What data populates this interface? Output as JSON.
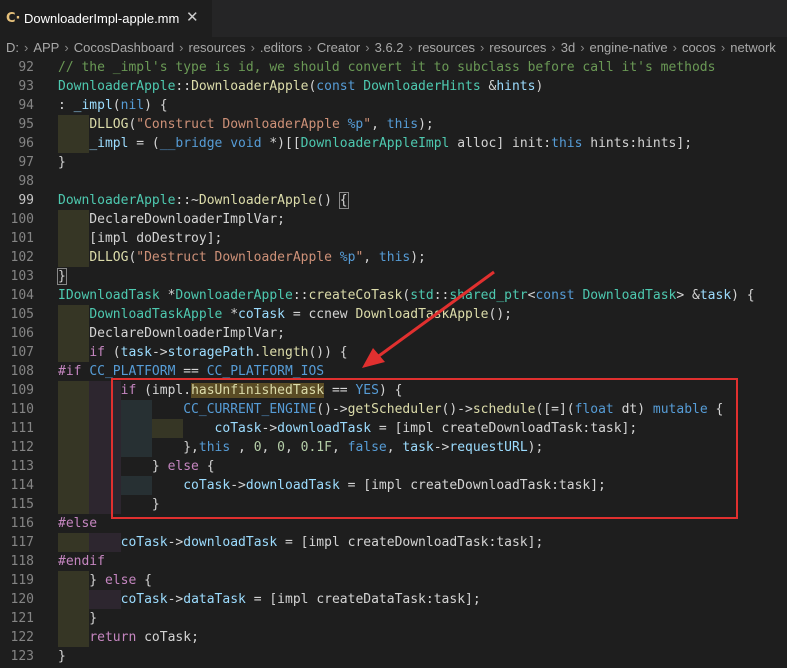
{
  "tab": {
    "icon": "C·",
    "label": "DownloaderImpl-apple.mm",
    "close": "✕"
  },
  "breadcrumb": [
    "D:",
    "APP",
    "CocosDashboard",
    "resources",
    ".editors",
    "Creator",
    "3.6.2",
    "resources",
    "resources",
    "3d",
    "engine-native",
    "cocos",
    "network"
  ],
  "breadcrumb_sep": "›",
  "colors": {
    "comment": "#6a9955",
    "keyword": "#569cd6",
    "control": "#c586c0",
    "type": "#4ec9b0",
    "function": "#dcdcaa",
    "variable": "#9cdcfe",
    "string": "#ce9178",
    "number": "#b5cea8",
    "macro": "#569cd6",
    "text": "#d4d4d4",
    "highlight_box": "#e1302f"
  },
  "lines": [
    {
      "n": 92,
      "parts": [
        [
          "c",
          "// the _impl's type is id, we should convert it to subclass before call it's methods"
        ]
      ]
    },
    {
      "n": 93,
      "parts": [
        [
          "y",
          "DownloaderApple"
        ],
        [
          "p",
          "::"
        ],
        [
          "f",
          "DownloaderApple"
        ],
        [
          "p",
          "("
        ],
        [
          "k",
          "const"
        ],
        [
          "p",
          " "
        ],
        [
          "y",
          "DownloaderHints"
        ],
        [
          "p",
          " &"
        ],
        [
          "v",
          "hints"
        ],
        [
          "p",
          ")"
        ]
      ]
    },
    {
      "n": 94,
      "parts": [
        [
          "p",
          ": "
        ],
        [
          "v",
          "_impl"
        ],
        [
          "p",
          "("
        ],
        [
          "k",
          "nil"
        ],
        [
          "p",
          ") {"
        ]
      ]
    },
    {
      "n": 95,
      "parts": [
        [
          "p",
          "    "
        ],
        [
          "f",
          "DLLOG"
        ],
        [
          "p",
          "("
        ],
        [
          "s",
          "\"Construct DownloaderApple "
        ],
        [
          "k",
          "%p"
        ],
        [
          "s",
          "\""
        ],
        [
          "p",
          ", "
        ],
        [
          "k",
          "this"
        ],
        [
          "p",
          ");"
        ]
      ]
    },
    {
      "n": 96,
      "parts": [
        [
          "p",
          "    "
        ],
        [
          "v",
          "_impl"
        ],
        [
          "p",
          " = ("
        ],
        [
          "k",
          "__bridge"
        ],
        [
          "p",
          " "
        ],
        [
          "k",
          "void"
        ],
        [
          "p",
          " *)[["
        ],
        [
          "y",
          "DownloaderAppleImpl"
        ],
        [
          "p",
          " alloc] init:"
        ],
        [
          "k",
          "this"
        ],
        [
          "p",
          " hints:hints];"
        ]
      ]
    },
    {
      "n": 97,
      "parts": [
        [
          "p",
          "}"
        ]
      ]
    },
    {
      "n": 98,
      "parts": []
    },
    {
      "n": 99,
      "parts": [
        [
          "y",
          "DownloaderApple"
        ],
        [
          "p",
          "::~"
        ],
        [
          "f",
          "DownloaderApple"
        ],
        [
          "p",
          "() "
        ],
        [
          "p",
          "{"
        ]
      ]
    },
    {
      "n": 100,
      "parts": [
        [
          "p",
          "    DeclareDownloaderImplVar;"
        ]
      ]
    },
    {
      "n": 101,
      "parts": [
        [
          "p",
          "    [impl doDestroy];"
        ]
      ]
    },
    {
      "n": 102,
      "parts": [
        [
          "p",
          "    "
        ],
        [
          "f",
          "DLLOG"
        ],
        [
          "p",
          "("
        ],
        [
          "s",
          "\"Destruct DownloaderApple "
        ],
        [
          "k",
          "%p"
        ],
        [
          "s",
          "\""
        ],
        [
          "p",
          ", "
        ],
        [
          "k",
          "this"
        ],
        [
          "p",
          ");"
        ]
      ]
    },
    {
      "n": 103,
      "parts": [
        [
          "p",
          "}"
        ]
      ]
    },
    {
      "n": 104,
      "parts": [
        [
          "y",
          "IDownloadTask"
        ],
        [
          "p",
          " *"
        ],
        [
          "y",
          "DownloaderApple"
        ],
        [
          "p",
          "::"
        ],
        [
          "f",
          "createCoTask"
        ],
        [
          "p",
          "("
        ],
        [
          "y",
          "std"
        ],
        [
          "p",
          "::"
        ],
        [
          "y",
          "shared_ptr"
        ],
        [
          "p",
          "<"
        ],
        [
          "k",
          "const"
        ],
        [
          "p",
          " "
        ],
        [
          "y",
          "DownloadTask"
        ],
        [
          "p",
          "> &"
        ],
        [
          "v",
          "task"
        ],
        [
          "p",
          ") {"
        ]
      ]
    },
    {
      "n": 105,
      "parts": [
        [
          "p",
          "    "
        ],
        [
          "y",
          "DownloadTaskApple"
        ],
        [
          "p",
          " *"
        ],
        [
          "v",
          "coTask"
        ],
        [
          "p",
          " = ccnew "
        ],
        [
          "f",
          "DownloadTaskApple"
        ],
        [
          "p",
          "();"
        ]
      ]
    },
    {
      "n": 106,
      "parts": [
        [
          "p",
          "    DeclareDownloaderImplVar;"
        ]
      ]
    },
    {
      "n": 107,
      "parts": [
        [
          "p",
          "    "
        ],
        [
          "x",
          "if"
        ],
        [
          "p",
          " ("
        ],
        [
          "v",
          "task"
        ],
        [
          "p",
          "->"
        ],
        [
          "v",
          "storagePath"
        ],
        [
          "p",
          "."
        ],
        [
          "f",
          "length"
        ],
        [
          "p",
          "()) {"
        ]
      ]
    },
    {
      "n": 108,
      "parts": [
        [
          "x",
          "#if"
        ],
        [
          "p",
          " "
        ],
        [
          "k",
          "CC_PLATFORM"
        ],
        [
          "p",
          " == "
        ],
        [
          "k",
          "CC_PLATFORM_IOS"
        ]
      ]
    },
    {
      "n": 109,
      "parts": [
        [
          "p",
          "        "
        ],
        [
          "x",
          "if"
        ],
        [
          "p",
          " (impl."
        ],
        [
          "h",
          "hasUnfinishedTask"
        ],
        [
          "p",
          " == "
        ],
        [
          "k",
          "YES"
        ],
        [
          "p",
          ") {"
        ]
      ]
    },
    {
      "n": 110,
      "parts": [
        [
          "p",
          "                "
        ],
        [
          "k",
          "CC_CURRENT_ENGINE"
        ],
        [
          "p",
          "()->"
        ],
        [
          "f",
          "getScheduler"
        ],
        [
          "p",
          "()->"
        ],
        [
          "f",
          "schedule"
        ],
        [
          "p",
          "([=]("
        ],
        [
          "k",
          "float"
        ],
        [
          "p",
          " dt) "
        ],
        [
          "k",
          "mutable"
        ],
        [
          "p",
          " {"
        ]
      ]
    },
    {
      "n": 111,
      "parts": [
        [
          "p",
          "                    "
        ],
        [
          "v",
          "coTask"
        ],
        [
          "p",
          "->"
        ],
        [
          "v",
          "downloadTask"
        ],
        [
          "p",
          " = [impl createDownloadTask:task];"
        ]
      ]
    },
    {
      "n": 112,
      "parts": [
        [
          "p",
          "                },"
        ],
        [
          "k",
          "this"
        ],
        [
          "p",
          " , "
        ],
        [
          "n",
          "0"
        ],
        [
          "p",
          ", "
        ],
        [
          "n",
          "0"
        ],
        [
          "p",
          ", "
        ],
        [
          "n",
          "0.1F"
        ],
        [
          "p",
          ", "
        ],
        [
          "k",
          "false"
        ],
        [
          "p",
          ", "
        ],
        [
          "v",
          "task"
        ],
        [
          "p",
          "->"
        ],
        [
          "v",
          "requestURL"
        ],
        [
          "p",
          ");"
        ]
      ]
    },
    {
      "n": 113,
      "parts": [
        [
          "p",
          "            } "
        ],
        [
          "x",
          "else"
        ],
        [
          "p",
          " {"
        ]
      ]
    },
    {
      "n": 114,
      "parts": [
        [
          "p",
          "                "
        ],
        [
          "v",
          "coTask"
        ],
        [
          "p",
          "->"
        ],
        [
          "v",
          "downloadTask"
        ],
        [
          "p",
          " = [impl createDownloadTask:task];"
        ]
      ]
    },
    {
      "n": 115,
      "parts": [
        [
          "p",
          "            }"
        ]
      ]
    },
    {
      "n": 116,
      "parts": [
        [
          "x",
          "#else"
        ]
      ]
    },
    {
      "n": 117,
      "parts": [
        [
          "p",
          "        "
        ],
        [
          "v",
          "coTask"
        ],
        [
          "p",
          "->"
        ],
        [
          "v",
          "downloadTask"
        ],
        [
          "p",
          " = [impl createDownloadTask:task];"
        ]
      ]
    },
    {
      "n": 118,
      "parts": [
        [
          "x",
          "#endif"
        ]
      ]
    },
    {
      "n": 119,
      "parts": [
        [
          "p",
          "    } "
        ],
        [
          "x",
          "else"
        ],
        [
          "p",
          " {"
        ]
      ]
    },
    {
      "n": 120,
      "parts": [
        [
          "p",
          "        "
        ],
        [
          "v",
          "coTask"
        ],
        [
          "p",
          "->"
        ],
        [
          "v",
          "dataTask"
        ],
        [
          "p",
          " = [impl createDataTask:task];"
        ]
      ]
    },
    {
      "n": 121,
      "parts": [
        [
          "p",
          "    }"
        ]
      ]
    },
    {
      "n": 122,
      "parts": [
        [
          "p",
          "    "
        ],
        [
          "x",
          "return"
        ],
        [
          "p",
          " coTask;"
        ]
      ]
    },
    {
      "n": 123,
      "parts": [
        [
          "p",
          "}"
        ]
      ]
    }
  ]
}
